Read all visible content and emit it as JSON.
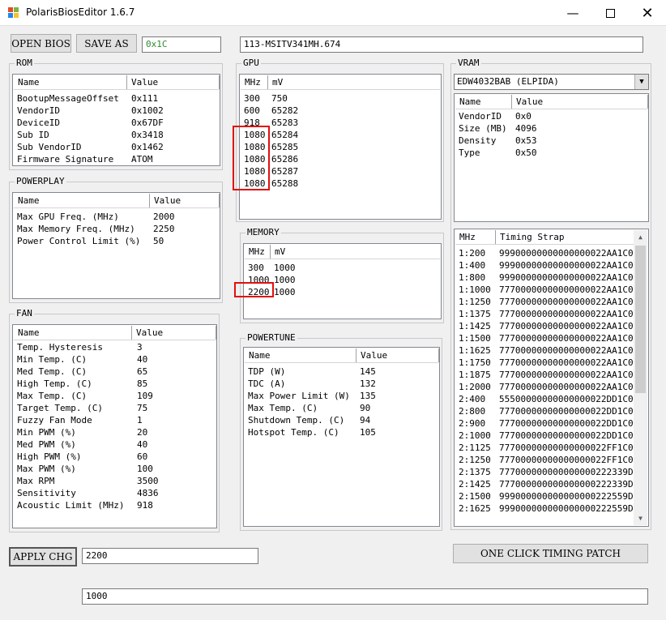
{
  "window": {
    "title": "PolarisBiosEditor 1.6.7"
  },
  "toolbar": {
    "open": "OPEN BIOS",
    "save": "SAVE AS",
    "checksum": "0x1C",
    "biosname": "113-MSITV341MH.674"
  },
  "rom": {
    "label": "ROM",
    "headers": [
      "Name",
      "Value"
    ],
    "rows": [
      [
        "BootupMessageOffset",
        "0x111"
      ],
      [
        "VendorID",
        "0x1002"
      ],
      [
        "DeviceID",
        "0x67DF"
      ],
      [
        "Sub ID",
        "0x3418"
      ],
      [
        "Sub VendorID",
        "0x1462"
      ],
      [
        "Firmware Signature",
        "ATOM"
      ]
    ]
  },
  "powerplay": {
    "label": "POWERPLAY",
    "headers": [
      "Name",
      "Value"
    ],
    "rows": [
      [
        "Max GPU Freq. (MHz)",
        "2000"
      ],
      [
        "Max Memory Freq. (MHz)",
        "2250"
      ],
      [
        "Power Control Limit (%)",
        "50"
      ]
    ]
  },
  "fan": {
    "label": "FAN",
    "headers": [
      "Name",
      "Value"
    ],
    "rows": [
      [
        "Temp. Hysteresis",
        "3"
      ],
      [
        "Min Temp. (C)",
        "40"
      ],
      [
        "Med Temp. (C)",
        "65"
      ],
      [
        "High Temp. (C)",
        "85"
      ],
      [
        "Max Temp. (C)",
        "109"
      ],
      [
        "Target Temp. (C)",
        "75"
      ],
      [
        "Fuzzy Fan Mode",
        "1"
      ],
      [
        "Min PWM (%)",
        "20"
      ],
      [
        "Med PWM (%)",
        "40"
      ],
      [
        "High PWM (%)",
        "60"
      ],
      [
        "Max PWM (%)",
        "100"
      ],
      [
        "Max RPM",
        "3500"
      ],
      [
        "Sensitivity",
        "4836"
      ],
      [
        "Acoustic Limit (MHz)",
        "918"
      ]
    ]
  },
  "gpu": {
    "label": "GPU",
    "headers": [
      "MHz",
      "mV"
    ],
    "rows": [
      [
        "300",
        "750"
      ],
      [
        "600",
        "65282"
      ],
      [
        "918",
        "65283"
      ],
      [
        "1080",
        "65284"
      ],
      [
        "1080",
        "65285"
      ],
      [
        "1080",
        "65286"
      ],
      [
        "1080",
        "65287"
      ],
      [
        "1080",
        "65288"
      ]
    ]
  },
  "memory": {
    "label": "MEMORY",
    "headers": [
      "MHz",
      "mV"
    ],
    "rows": [
      [
        "300",
        "1000"
      ],
      [
        "1000",
        "1000"
      ],
      [
        "2200",
        "1000"
      ]
    ]
  },
  "powertune": {
    "label": "POWERTUNE",
    "headers": [
      "Name",
      "Value"
    ],
    "rows": [
      [
        "TDP (W)",
        "145"
      ],
      [
        "TDC (A)",
        "132"
      ],
      [
        "Max Power Limit (W)",
        "135"
      ],
      [
        "Max Temp. (C)",
        "90"
      ],
      [
        "Shutdown Temp. (C)",
        "94"
      ],
      [
        "Hotspot Temp. (C)",
        "105"
      ]
    ]
  },
  "vram": {
    "label": "VRAM",
    "selected": "EDW4032BAB (ELPIDA)",
    "headers": [
      "Name",
      "Value"
    ],
    "rows": [
      [
        "VendorID",
        "0x0"
      ],
      [
        "Size (MB)",
        "4096"
      ],
      [
        "Density",
        "0x53"
      ],
      [
        "Type",
        "0x50"
      ]
    ]
  },
  "timing": {
    "headers": [
      "MHz",
      "Timing Strap"
    ],
    "rows": [
      [
        "1:200",
        "99900000000000000022AA1C00"
      ],
      [
        "1:400",
        "99900000000000000022AA1C00"
      ],
      [
        "1:800",
        "99900000000000000022AA1C00"
      ],
      [
        "1:1000",
        "77700000000000000022AA1C00"
      ],
      [
        "1:1250",
        "77700000000000000022AA1C00"
      ],
      [
        "1:1375",
        "77700000000000000022AA1C00"
      ],
      [
        "1:1425",
        "77700000000000000022AA1C00"
      ],
      [
        "1:1500",
        "77700000000000000022AA1C00"
      ],
      [
        "1:1625",
        "77700000000000000022AA1C00"
      ],
      [
        "1:1750",
        "77700000000000000022AA1C00"
      ],
      [
        "1:1875",
        "77700000000000000022AA1C00"
      ],
      [
        "1:2000",
        "77700000000000000022AA1C00"
      ],
      [
        "2:400",
        "55500000000000000022DD1C00"
      ],
      [
        "2:800",
        "77700000000000000022DD1C00"
      ],
      [
        "2:900",
        "77700000000000000022DD1C00"
      ],
      [
        "2:1000",
        "77700000000000000022DD1C00"
      ],
      [
        "2:1125",
        "77700000000000000022FF1C00"
      ],
      [
        "2:1250",
        "77700000000000000022FF1C00"
      ],
      [
        "2:1375",
        "777000000000000000222339D00"
      ],
      [
        "2:1425",
        "777000000000000000222339D00"
      ],
      [
        "2:1500",
        "999000000000000000222559D00"
      ],
      [
        "2:1625",
        "999000000000000000222559D00"
      ]
    ]
  },
  "bottom": {
    "apply": "APPLY CHG",
    "apply_value": "2200",
    "patch": "ONE CLICK TIMING PATCH",
    "bottom_value": "1000"
  }
}
